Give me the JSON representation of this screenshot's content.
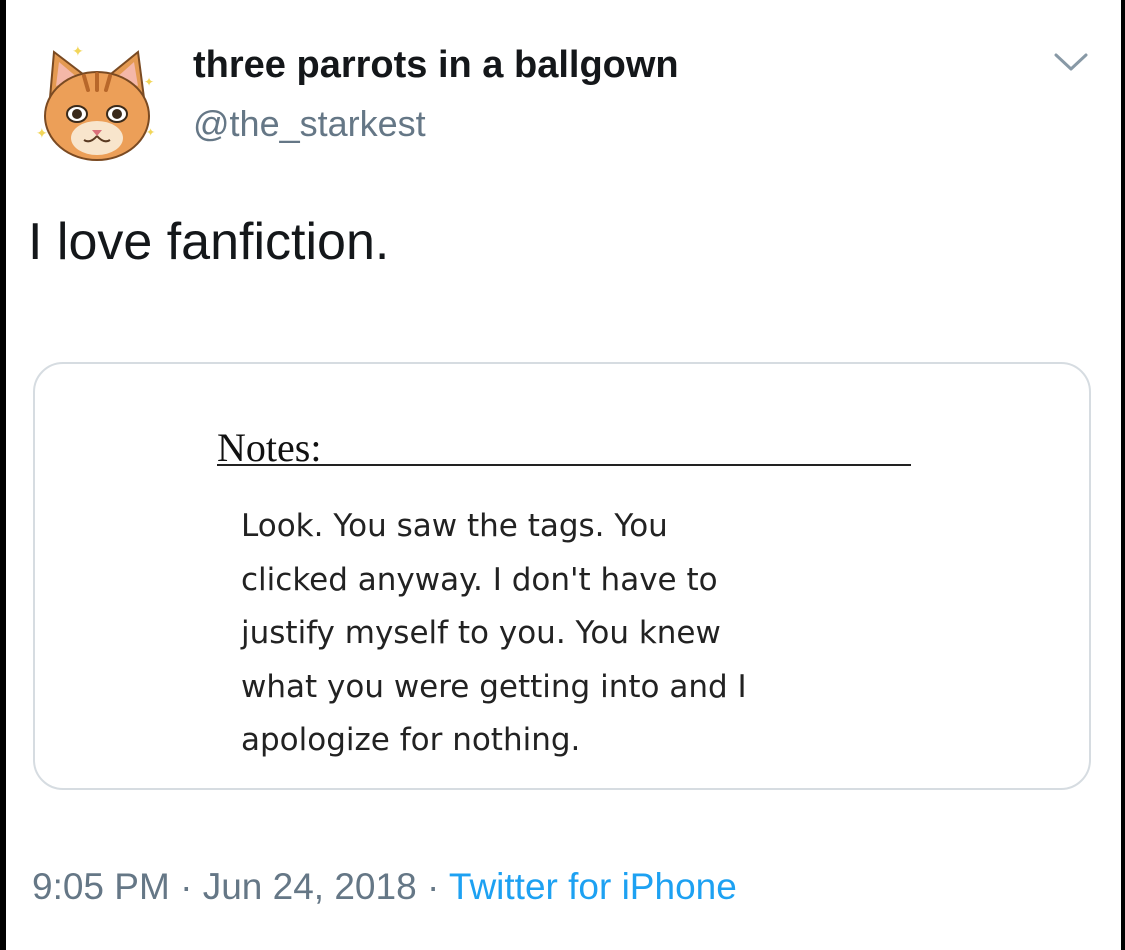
{
  "tweet": {
    "display_name": "three parrots in a ballgown",
    "handle": "@the_starkest",
    "text": "I love fanfiction.",
    "avatar_icon": "cat-avatar-icon",
    "menu_icon": "chevron-down-icon"
  },
  "embedded_image": {
    "heading": "Notes:",
    "body_lines": [
      "Look. You saw the tags. You",
      "clicked anyway. I don't have to",
      "justify myself to you. You knew",
      "what you were getting into and I",
      "apologize for nothing."
    ]
  },
  "footer": {
    "time": "9:05 PM",
    "separator": "·",
    "date": "Jun 24, 2018",
    "source": "Twitter for iPhone"
  },
  "colors": {
    "text_primary": "#14171a",
    "text_secondary": "#657786",
    "link": "#1da1f2",
    "card_border": "#d6dce1"
  }
}
